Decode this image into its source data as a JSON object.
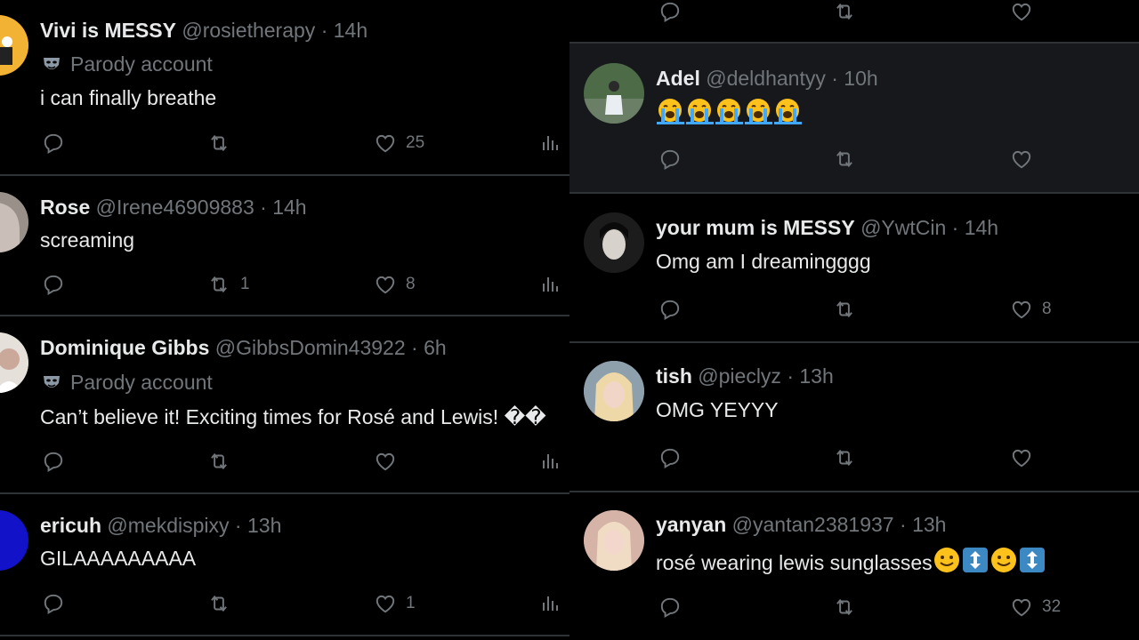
{
  "left_column": {
    "tweets": [
      {
        "name": "Vivi is MESSY",
        "handle": "@rosietherapy",
        "time": "14h",
        "badge": "Parody account",
        "text": "i can finally breathe",
        "retweets": "",
        "likes": "25"
      },
      {
        "name": "Rose",
        "handle": "@Irene46909883",
        "time": "14h",
        "badge": "",
        "text": "screaming",
        "retweets": "1",
        "likes": "8"
      },
      {
        "name": "Dominique Gibbs",
        "handle": "@GibbsDomin43922",
        "time": "6h",
        "badge": "Parody account",
        "text": "Can’t believe it! Exciting times for Rosé and Lewis! ��",
        "retweets": "",
        "likes": ""
      },
      {
        "name": "ericuh",
        "handle": "@mekdispixy",
        "time": "13h",
        "badge": "",
        "text": "GILAAAAAAAAA",
        "retweets": "",
        "likes": "1"
      }
    ]
  },
  "right_column": {
    "tweets": [
      {
        "name": "Adel",
        "handle": "@deldhantyy",
        "time": "10h",
        "text": "",
        "emoji": "loudly-crying-face x5",
        "retweets": "",
        "likes": ""
      },
      {
        "name": "your mum is MESSY",
        "handle": "@YwtCin",
        "time": "14h",
        "text": "Omg am I dreamingggg",
        "retweets": "",
        "likes": "8"
      },
      {
        "name": "tish",
        "handle": "@pieclyz",
        "time": "13h",
        "text": "OMG YEYYY",
        "retweets": "",
        "likes": ""
      },
      {
        "name": "yanyan",
        "handle": "@yantan2381937",
        "time": "13h",
        "text": "rosé wearing lewis sunglasses",
        "emoji": "slightly-smiling-face, up-down-arrow, slightly-smiling-face, up-down-arrow",
        "retweets": "",
        "likes": "32"
      }
    ]
  },
  "colors": {
    "background": "#000000",
    "highlight_background": "#16181c",
    "separator": "#2f3336",
    "primary_text": "#e7e9ea",
    "secondary_text": "#71767b"
  },
  "icons": {
    "reply": "reply-icon",
    "retweet": "retweet-icon",
    "like": "heart-icon",
    "views": "views-icon",
    "parody": "parody-mask-icon"
  },
  "separator_char": "·"
}
